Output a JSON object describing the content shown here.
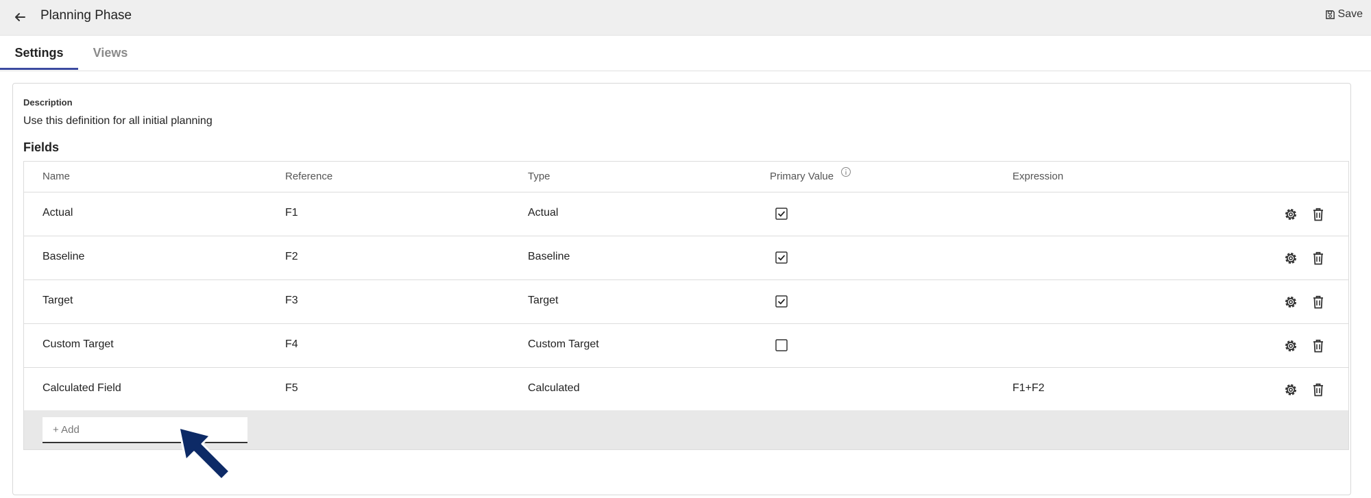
{
  "header": {
    "title": "Planning Phase",
    "save_label": "Save",
    "back_icon": "back-arrow-icon",
    "save_icon": "floppy-disk-icon"
  },
  "tabs": [
    {
      "label": "Settings",
      "active": true
    },
    {
      "label": "Views",
      "active": false
    }
  ],
  "description": {
    "label": "Description",
    "text": "Use this definition for all initial planning"
  },
  "fields": {
    "title": "Fields",
    "columns": [
      "Name",
      "Reference",
      "Type",
      "Primary Value",
      "Expression"
    ],
    "rows": [
      {
        "name": "Actual",
        "reference": "F1",
        "type": "Actual",
        "primary": true,
        "expression": ""
      },
      {
        "name": "Baseline",
        "reference": "F2",
        "type": "Baseline",
        "primary": true,
        "expression": ""
      },
      {
        "name": "Target",
        "reference": "F3",
        "type": "Target",
        "primary": true,
        "expression": ""
      },
      {
        "name": "Custom Target",
        "reference": "F4",
        "type": "Custom Target",
        "primary": false,
        "expression": ""
      },
      {
        "name": "Calculated Field",
        "reference": "F5",
        "type": "Calculated",
        "primary": null,
        "expression": "F1+F2"
      }
    ],
    "add_placeholder": "+ Add"
  },
  "colors": {
    "accent": "#3b4aa0",
    "arrow": "#0d2a66"
  }
}
